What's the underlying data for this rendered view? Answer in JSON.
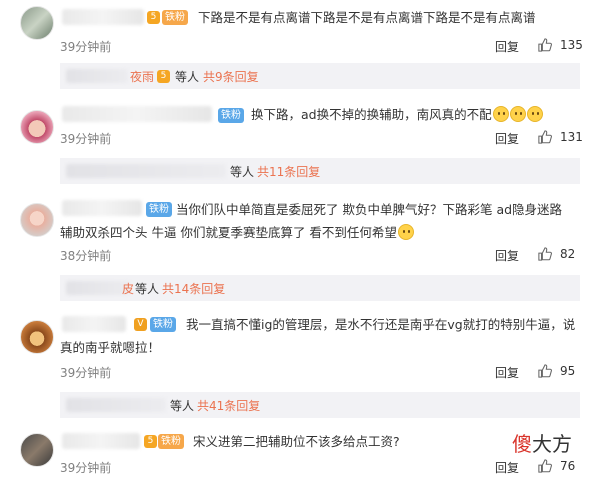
{
  "reply_label": "回复",
  "comments": [
    {
      "text": "下路是不是有点离谱下路是不是有点离谱下路是不是有点离谱",
      "badge": "铁粉",
      "time": "39分钟前",
      "likes": "135",
      "subthread": {
        "name": "夜雨",
        "others": "等人",
        "count": "共9条回复"
      }
    },
    {
      "text": "换下路，ad换不掉的换辅助，南风真的不配",
      "badge": "铁粉",
      "time": "39分钟前",
      "likes": "131",
      "subthread": {
        "others": "等人",
        "count": "共11条回复"
      }
    },
    {
      "text": "当你们队中单简直是委屈死了 欺负中单脾气好？下路彩笔  ad隐身迷路 辅助双杀四个头 牛逼 你们就夏季赛垫底算了 看不到任何希望",
      "badge": "铁粉",
      "time": "38分钟前",
      "likes": "82",
      "subthread": {
        "name": "皮",
        "others": "等人",
        "count": "共14条回复"
      }
    },
    {
      "text": "我一直搞不懂ig的管理层，是水不行还是南乎在vg就打的特别牛逼，说真的南乎就嗯拉！",
      "badge": "铁粉",
      "time": "39分钟前",
      "likes": "95",
      "subthread": {
        "others": "等人",
        "count": "共41条回复"
      }
    },
    {
      "text": "宋义进第二把辅助位不该多给点工资?",
      "badge": "铁粉",
      "time": "39分钟前",
      "likes": "76"
    }
  ],
  "watermark": {
    "first": "傻",
    "rest": "大方"
  },
  "colors": {
    "accent": "#eb7350",
    "fan_badge": "#5aa7e8",
    "subbar": "#f2f2f5"
  }
}
